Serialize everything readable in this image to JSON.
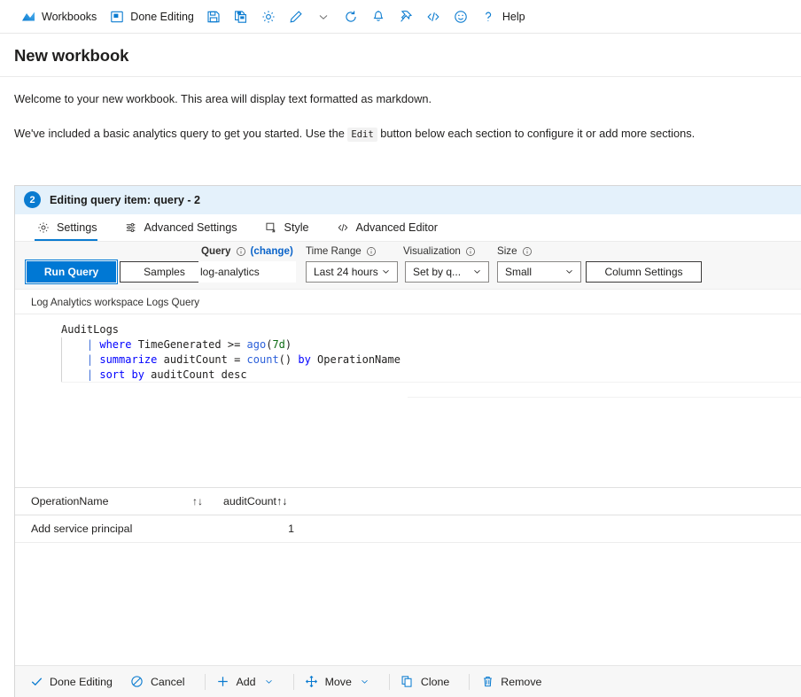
{
  "toolbar": {
    "items": [
      {
        "label": "Workbooks",
        "icon": "workbooks-logo-icon",
        "has_label": true
      },
      {
        "label": "Done Editing",
        "icon": "done-editing-icon",
        "has_label": true
      },
      {
        "label": "",
        "icon": "save-icon",
        "has_label": false
      },
      {
        "label": "",
        "icon": "save-as-icon",
        "has_label": false
      },
      {
        "label": "",
        "icon": "gear-icon",
        "has_label": false
      },
      {
        "label": "",
        "icon": "edit-pencil-icon",
        "has_label": false
      },
      {
        "label": "",
        "icon": "chevron-down-icon",
        "has_label": false
      },
      {
        "label": "",
        "icon": "refresh-icon",
        "has_label": false
      },
      {
        "label": "",
        "icon": "alert-bell-icon",
        "has_label": false
      },
      {
        "label": "",
        "icon": "pin-icon",
        "has_label": false
      },
      {
        "label": "",
        "icon": "code-brackets-icon",
        "has_label": false
      },
      {
        "label": "",
        "icon": "smiley-feedback-icon",
        "has_label": false
      },
      {
        "label": "Help",
        "icon": "question-mark-icon",
        "has_label": true
      }
    ]
  },
  "page": {
    "title": "New workbook",
    "markdown_p1": "Welcome to your new workbook. This area will display text formatted as markdown.",
    "markdown_p2_before": "We've included a basic analytics query to get you started. Use the",
    "markdown_p2_code": "Edit",
    "markdown_p2_after": "button below each section to configure it or add more sections."
  },
  "panel": {
    "badge": "2",
    "title": "Editing query item: query - 2",
    "accent_color": "#0a7bd0",
    "header_bg": "#e4f1fb",
    "tabs": [
      {
        "label": "Settings",
        "icon": "gear-icon",
        "active": true
      },
      {
        "label": "Advanced Settings",
        "icon": "sliders-icon",
        "active": false
      },
      {
        "label": "Style",
        "icon": "style-square-icon",
        "active": false
      },
      {
        "label": "Advanced Editor",
        "icon": "code-brackets-icon",
        "active": false
      }
    ]
  },
  "controls": {
    "run_query_label": "Run Query",
    "samples_label": "Samples",
    "query_label": "Query",
    "query_change_link": "(change)",
    "query_value": "log-analytics",
    "time_range_label": "Time Range",
    "time_range_value": "Last 24 hours",
    "visualization_label": "Visualization",
    "visualization_value": "Set by q...",
    "size_label": "Size",
    "size_value": "Small",
    "column_settings_label": "Column Settings"
  },
  "editor": {
    "label": "Log Analytics workspace Logs Query",
    "lines": [
      {
        "indent": 0,
        "tokens": [
          {
            "t": "AuditLogs",
            "c": "plain"
          }
        ]
      },
      {
        "indent": 1,
        "tokens": [
          {
            "t": "| ",
            "c": "pipe"
          },
          {
            "t": "where",
            "c": "kw"
          },
          {
            "t": " TimeGenerated >= ",
            "c": "plain"
          },
          {
            "t": "ago",
            "c": "fn"
          },
          {
            "t": "(",
            "c": "plain"
          },
          {
            "t": "7d",
            "c": "num"
          },
          {
            "t": ")",
            "c": "plain"
          }
        ]
      },
      {
        "indent": 1,
        "tokens": [
          {
            "t": "| ",
            "c": "pipe"
          },
          {
            "t": "summarize",
            "c": "kw"
          },
          {
            "t": " auditCount = ",
            "c": "plain"
          },
          {
            "t": "count",
            "c": "fn"
          },
          {
            "t": "() ",
            "c": "plain"
          },
          {
            "t": "by",
            "c": "kw"
          },
          {
            "t": " OperationName",
            "c": "plain"
          }
        ]
      },
      {
        "indent": 1,
        "tokens": [
          {
            "t": "| ",
            "c": "pipe"
          },
          {
            "t": "sort",
            "c": "kw"
          },
          {
            "t": " ",
            "c": "plain"
          },
          {
            "t": "by",
            "c": "kw"
          },
          {
            "t": " auditCount desc",
            "c": "plain"
          }
        ]
      }
    ]
  },
  "results": {
    "columns": [
      {
        "label": "OperationName",
        "sort_icon": "sort-updown-icon"
      },
      {
        "label": "auditCount",
        "sort_icon": "sort-updown-icon"
      }
    ],
    "sort_glyph": "↑↓",
    "rows": [
      {
        "operation_name": "Add service principal",
        "audit_count": "1"
      }
    ]
  },
  "bottombar": {
    "items": [
      {
        "label": "Done Editing",
        "icon": "checkmark-icon",
        "chevron": false,
        "divider_after": false
      },
      {
        "label": "Cancel",
        "icon": "cancel-circle-icon",
        "chevron": false,
        "divider_after": true
      },
      {
        "label": "Add",
        "icon": "plus-icon",
        "chevron": true,
        "divider_after": true
      },
      {
        "label": "Move",
        "icon": "move-arrows-icon",
        "chevron": true,
        "divider_after": true
      },
      {
        "label": "Clone",
        "icon": "copy-icon",
        "chevron": false,
        "divider_after": true
      },
      {
        "label": "Remove",
        "icon": "trash-icon",
        "chevron": false,
        "divider_after": false
      }
    ]
  }
}
